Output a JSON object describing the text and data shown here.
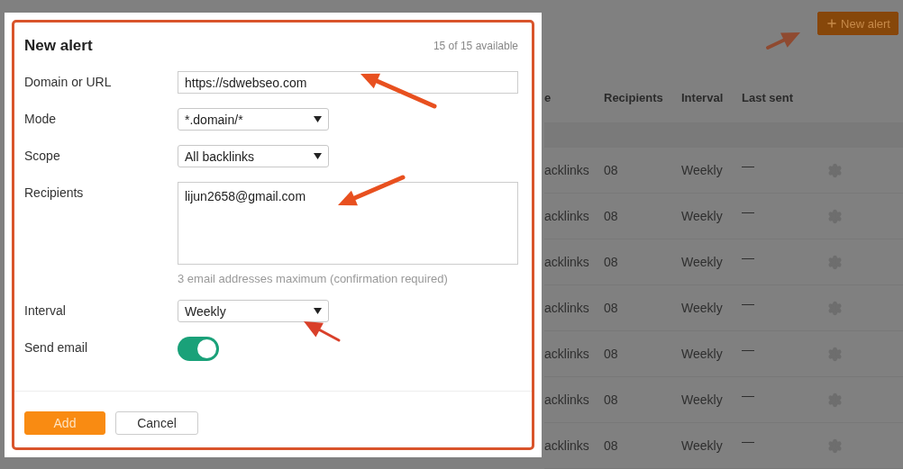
{
  "page": {
    "new_alert_button": {
      "label": "New alert"
    },
    "table": {
      "columns": [
        "e",
        "Recipients",
        "Interval",
        "Last sent"
      ],
      "rows": [
        {
          "column_1": "acklinks",
          "recipients": "08",
          "interval": "Weekly",
          "last_sent": "—"
        },
        {
          "column_1": "acklinks",
          "recipients": "08",
          "interval": "Weekly",
          "last_sent": "—"
        },
        {
          "column_1": "acklinks",
          "recipients": "08",
          "interval": "Weekly",
          "last_sent": "—"
        },
        {
          "column_1": "acklinks",
          "recipients": "08",
          "interval": "Weekly",
          "last_sent": "—"
        },
        {
          "column_1": "acklinks",
          "recipients": "08",
          "interval": "Weekly",
          "last_sent": "—"
        },
        {
          "column_1": "acklinks",
          "recipients": "08",
          "interval": "Weekly",
          "last_sent": "—"
        },
        {
          "column_1": "acklinks",
          "recipients": "08",
          "interval": "Weekly",
          "last_sent": "—"
        }
      ]
    }
  },
  "dialog": {
    "title": "New alert",
    "quota": "15 of 15 available",
    "fields": [
      {
        "kind": "text",
        "label": "Domain or URL",
        "value": "https://sdwebseo.com"
      },
      {
        "kind": "select",
        "label": "Mode",
        "value": "*.domain/*"
      },
      {
        "kind": "select",
        "label": "Scope",
        "value": "All backlinks"
      },
      {
        "kind": "textarea",
        "label": "Recipients",
        "value": "lijun2658@gmail.com",
        "hint": "3 email addresses maximum (confirmation required)"
      },
      {
        "kind": "select",
        "label": "Interval",
        "value": "Weekly"
      },
      {
        "kind": "toggle",
        "label": "Send email",
        "on": true
      }
    ],
    "buttons": [
      {
        "kind": "primary",
        "label": "Add"
      },
      {
        "kind": "secondary",
        "label": "Cancel"
      }
    ]
  }
}
